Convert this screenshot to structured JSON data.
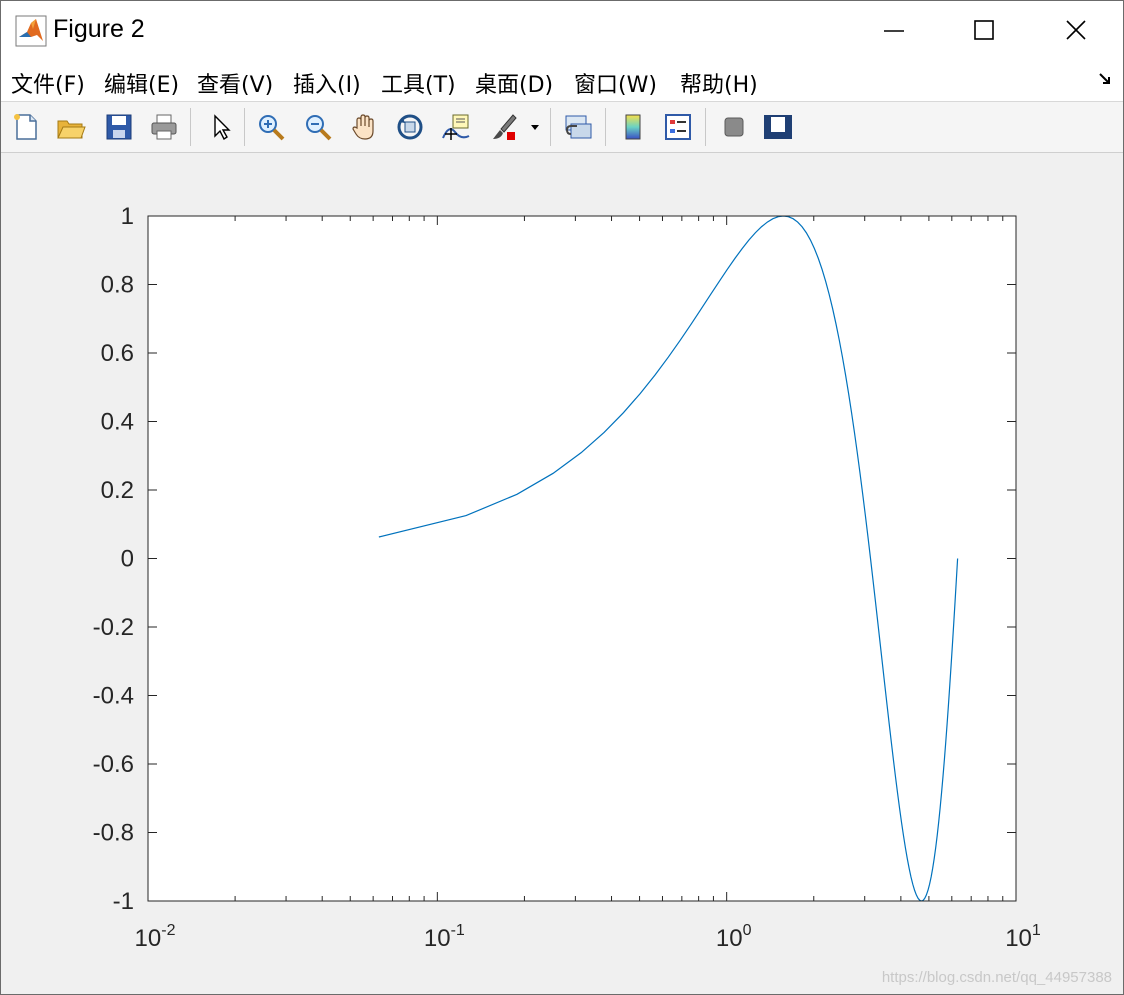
{
  "window": {
    "title": "Figure 2"
  },
  "menu": {
    "items": [
      "文件(F)",
      "编辑(E)",
      "查看(V)",
      "插入(I)",
      "工具(T)",
      "桌面(D)",
      "窗口(W)",
      "帮助(H)"
    ]
  },
  "toolbar": {
    "buttons": [
      "new-figure-icon",
      "open-file-icon",
      "save-icon",
      "print-icon",
      "edit-plot-arrow-icon",
      "zoom-in-icon",
      "zoom-out-icon",
      "pan-hand-icon",
      "rotate-3d-icon",
      "data-cursor-icon",
      "brush-icon",
      "link-plot-icon",
      "colorbar-icon",
      "legend-icon",
      "hide-plot-tools-icon",
      "show-plot-tools-icon"
    ]
  },
  "watermark": "https://blog.csdn.net/qq_44957388",
  "chart_data": {
    "type": "line",
    "xscale": "log",
    "xlim": [
      0.01,
      10
    ],
    "ylim": [
      -1,
      1
    ],
    "xticks": [
      0.01,
      0.1,
      1,
      10
    ],
    "xtick_labels": [
      {
        "base": "10",
        "exp": "-2"
      },
      {
        "base": "10",
        "exp": "-1"
      },
      {
        "base": "10",
        "exp": "0"
      },
      {
        "base": "10",
        "exp": "1"
      }
    ],
    "yticks": [
      -1,
      -0.8,
      -0.6,
      -0.4,
      -0.2,
      0,
      0.2,
      0.4,
      0.6,
      0.8,
      1
    ],
    "ytick_labels": [
      "-1",
      "-0.8",
      "-0.6",
      "-0.4",
      "-0.2",
      "0",
      "0.2",
      "0.4",
      "0.6",
      "0.8",
      "1"
    ],
    "series": [
      {
        "color": "#0072bd",
        "x": [
          0.0628,
          0.1257,
          0.1885,
          0.2513,
          0.3142,
          0.377,
          0.4398,
          0.5027,
          0.5655,
          0.6283,
          0.6912,
          0.754,
          0.8168,
          0.8796,
          0.9425,
          1.0053,
          1.0681,
          1.131,
          1.1938,
          1.2566,
          1.3195,
          1.3823,
          1.4451,
          1.508,
          1.5708,
          1.6336,
          1.6965,
          1.7593,
          1.8221,
          1.885,
          1.9478,
          2.0106,
          2.0735,
          2.1363,
          2.1991,
          2.2619,
          2.3248,
          2.3876,
          2.4504,
          2.5133,
          2.5761,
          2.6389,
          2.7018,
          2.7646,
          2.8274,
          2.8903,
          2.9531,
          3.0159,
          3.0788,
          3.1416,
          3.2044,
          3.2673,
          3.3301,
          3.3929,
          3.4558,
          3.5186,
          3.5814,
          3.6442,
          3.7071,
          3.7699,
          3.8327,
          3.8956,
          3.9584,
          4.0212,
          4.0841,
          4.1469,
          4.2097,
          4.2726,
          4.3354,
          4.3982,
          4.4611,
          4.5239,
          4.5867,
          4.6496,
          4.7124,
          4.7752,
          4.8381,
          4.9009,
          4.9637,
          5.0265,
          5.0894,
          5.1522,
          5.215,
          5.2779,
          5.3407,
          5.4035,
          5.4664,
          5.5292,
          5.592,
          5.6549,
          5.7177,
          5.7805,
          5.8434,
          5.9062,
          5.969,
          6.0319,
          6.0947,
          6.1575,
          6.2204,
          6.2832
        ],
        "y": [
          0.0628,
          0.1253,
          0.1874,
          0.2487,
          0.309,
          0.3681,
          0.4258,
          0.4818,
          0.5358,
          0.5878,
          0.6374,
          0.6845,
          0.729,
          0.7705,
          0.809,
          0.8443,
          0.8763,
          0.9048,
          0.9298,
          0.9511,
          0.9686,
          0.9823,
          0.9921,
          0.998,
          1.0,
          0.998,
          0.9921,
          0.9823,
          0.9686,
          0.9511,
          0.9298,
          0.9048,
          0.8763,
          0.8443,
          0.809,
          0.7705,
          0.729,
          0.6845,
          0.6374,
          0.5878,
          0.5358,
          0.4818,
          0.4258,
          0.3681,
          0.309,
          0.2487,
          0.1874,
          0.1253,
          0.0628,
          0.0,
          -0.0628,
          -0.1253,
          -0.1874,
          -0.2487,
          -0.309,
          -0.3681,
          -0.4258,
          -0.4818,
          -0.5358,
          -0.5878,
          -0.6374,
          -0.6845,
          -0.729,
          -0.7705,
          -0.809,
          -0.8443,
          -0.8763,
          -0.9048,
          -0.9298,
          -0.9511,
          -0.9686,
          -0.9823,
          -0.9921,
          -0.998,
          -1.0,
          -0.998,
          -0.9921,
          -0.9823,
          -0.9686,
          -0.9511,
          -0.9298,
          -0.9048,
          -0.8763,
          -0.8443,
          -0.809,
          -0.7705,
          -0.729,
          -0.6845,
          -0.6374,
          -0.5878,
          -0.5358,
          -0.4818,
          -0.4258,
          -0.3681,
          -0.309,
          -0.2487,
          -0.1874,
          -0.1253,
          -0.0628,
          0.0
        ]
      }
    ],
    "grid": false,
    "box": true
  }
}
